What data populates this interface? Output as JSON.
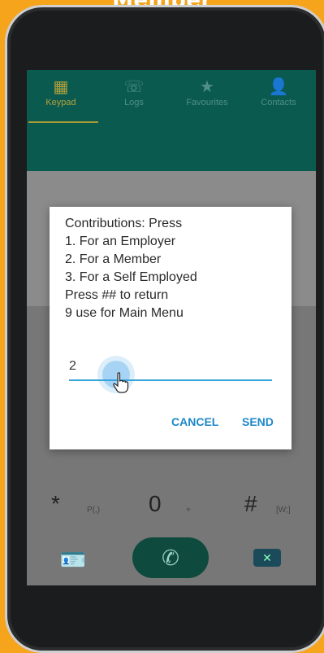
{
  "banner": {
    "title": "Member"
  },
  "tabs": [
    {
      "label": "Keypad",
      "icon": "keypad-icon"
    },
    {
      "label": "Logs",
      "icon": "call-log-icon"
    },
    {
      "label": "Favourites",
      "icon": "star-icon"
    },
    {
      "label": "Contacts",
      "icon": "person-icon"
    }
  ],
  "dialog": {
    "lines": [
      "Contributions: Press",
      "1. For an Employer",
      "2. For a Member",
      "3. For a Self Employed",
      "Press ## to return",
      "9 use for Main Menu"
    ],
    "input_value": "2",
    "cancel_label": "CANCEL",
    "send_label": "SEND"
  },
  "keypad": {
    "star": "*",
    "star_sub": "P(,)",
    "zero": "0",
    "zero_sub": "+",
    "hash": "#",
    "hash_sub": "[W;]"
  },
  "colors": {
    "background": "#f5a41c",
    "appbar": "#0a5a50",
    "accent": "#1e88c7",
    "input_line": "#36a5d8"
  }
}
